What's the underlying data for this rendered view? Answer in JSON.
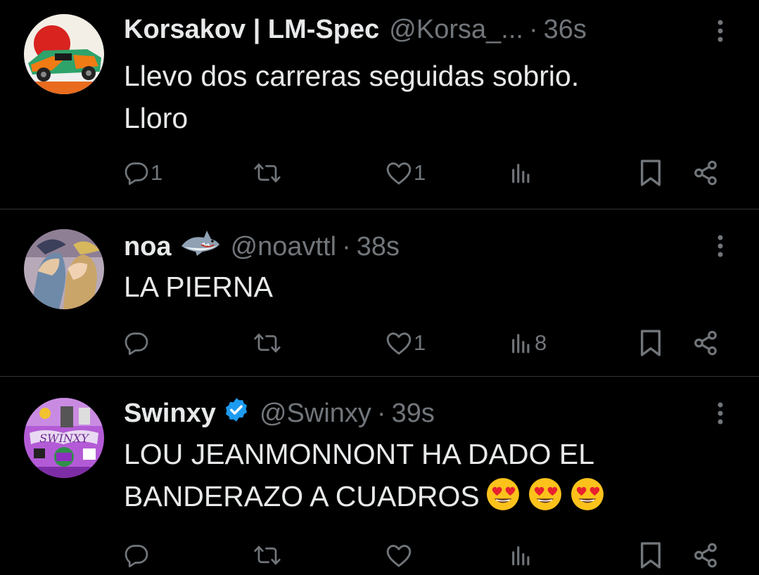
{
  "tweets": [
    {
      "name": "Korsakov | LM-Spec",
      "handle": "@Korsa_...",
      "dot": "·",
      "time": "36s",
      "lines": [
        "Llevo dos carreras seguidas sobrio.",
        "Lloro"
      ],
      "replies": "1",
      "retweets": "",
      "likes": "1",
      "views": "",
      "avatar": "car-livery-avatar"
    },
    {
      "name": "noa",
      "name_emoji": "shark-emoji",
      "handle": "@noavttl",
      "dot": "·",
      "time": "38s",
      "lines": [
        "LA PIERNA"
      ],
      "replies": "",
      "retweets": "",
      "likes": "1",
      "views": "8",
      "avatar": "anime-kiss-avatar"
    },
    {
      "name": "Swinxy",
      "verified": true,
      "handle": "@Swinxy",
      "dot": "·",
      "time": "39s",
      "lines": [
        "LOU JEANMONNONT HA DADO EL",
        "BANDERAZO A CUADROS"
      ],
      "body_emojis": [
        "heart-eyes-emoji",
        "heart-eyes-emoji",
        "heart-eyes-emoji"
      ],
      "replies": "",
      "retweets": "",
      "likes": "",
      "views": "",
      "avatar": "swinxy-gp-avatar"
    }
  ],
  "colors": {
    "background": "#000000",
    "text": "#e7e9ea",
    "muted": "#71767b",
    "divider": "#2f3336",
    "verified": "#1d9bf0"
  }
}
